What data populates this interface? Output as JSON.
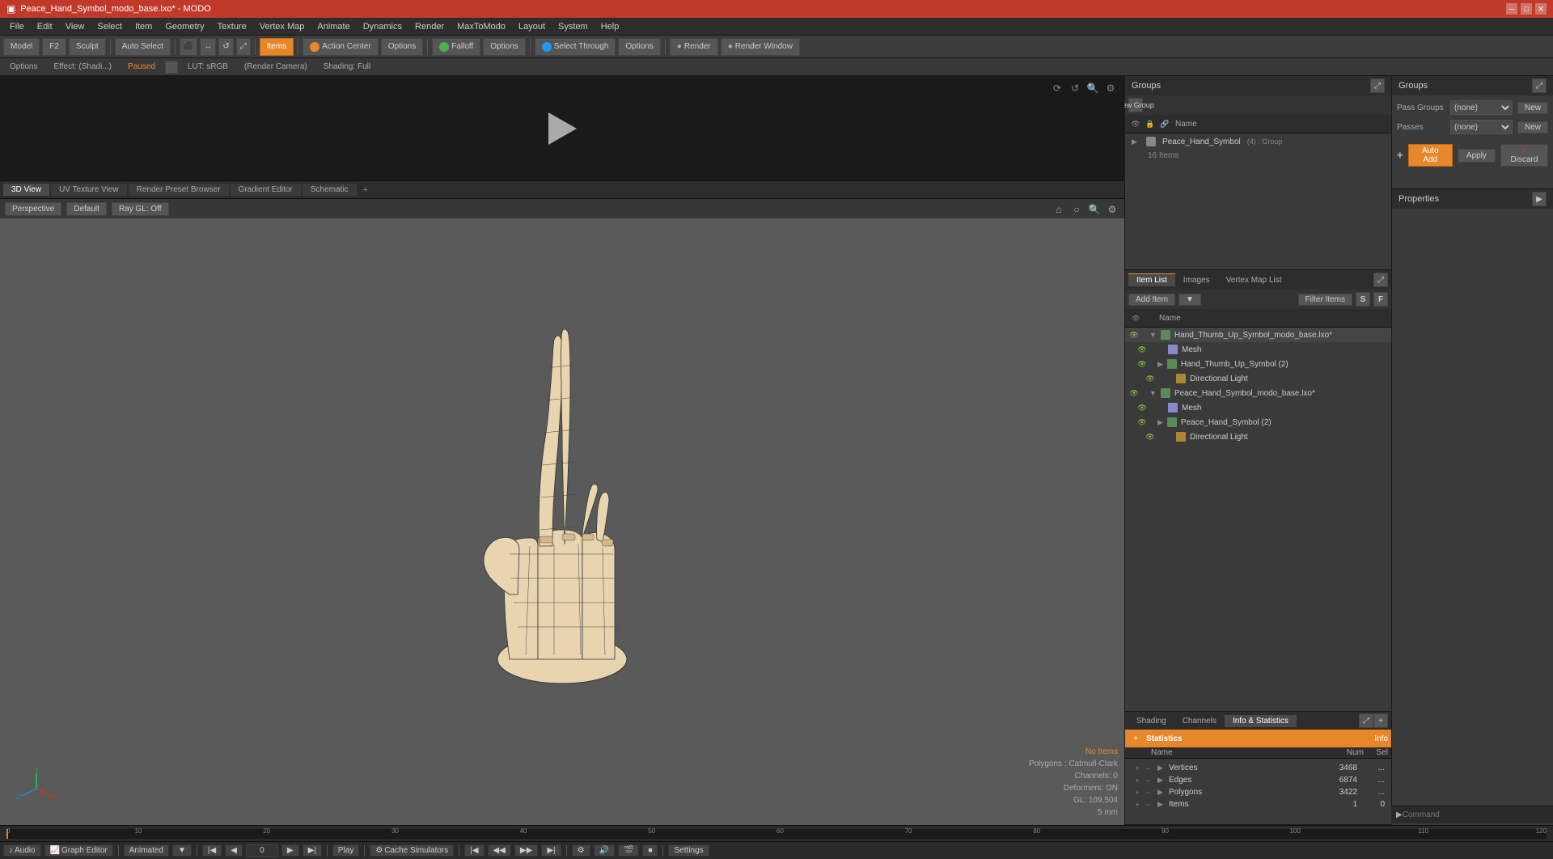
{
  "window": {
    "title": "Peace_Hand_Symbol_modo_base.lxo* - MODO",
    "icon": "modo-icon"
  },
  "menubar": {
    "items": [
      "File",
      "Edit",
      "View",
      "Select",
      "Item",
      "Geometry",
      "Texture",
      "Vertex Map",
      "Animate",
      "Dynamics",
      "Render",
      "MaxToModo",
      "Layout",
      "System",
      "Help"
    ]
  },
  "toolbar": {
    "model_label": "Model",
    "f2_label": "F2",
    "sculpt_label": "Sculpt",
    "auto_select_label": "Auto Select",
    "items_label": "Items",
    "action_center_label": "Action Center",
    "options_label": "Options",
    "falloff_label": "Falloff",
    "falloff_options": "Options",
    "select_through_label": "Select Through",
    "select_through_options": "Options",
    "render_label": "Render",
    "render_window_label": "Render Window"
  },
  "secondary_toolbar": {
    "left": "Options",
    "effect": "Effect: (Shadi...)",
    "status": "Paused",
    "lut": "LUT: sRGB",
    "render_camera": "(Render Camera)",
    "shading": "Shading: Full"
  },
  "viewport": {
    "tabs": [
      "3D View",
      "UV Texture View",
      "Render Preset Browser",
      "Gradient Editor",
      "Schematic"
    ],
    "active_tab": "3D View",
    "perspective_label": "Perspective",
    "default_label": "Default",
    "ray_gl": "Ray GL: Off",
    "stats": {
      "no_items": "No Items",
      "polygons": "Polygons : Catmull-Clark",
      "channels": "Channels: 0",
      "deformers": "Deformers: ON",
      "gl": "GL: 109,504",
      "unit": "5 mm"
    }
  },
  "groups_panel": {
    "title": "Groups",
    "new_group_label": "New Group",
    "name_col": "Name",
    "group_item": {
      "name": "Peace_Hand_Symbol",
      "meta": "(4) : Group",
      "sub": "16 Items"
    }
  },
  "item_list": {
    "title": "Item List",
    "tabs": [
      "Item List",
      "Images",
      "Vertex Map List"
    ],
    "add_item": "Add Item",
    "filter_items": "Filter Items",
    "name_col": "Name",
    "items": [
      {
        "name": "Hand_Thumb_Up_Symbol_modo_base.lxo*",
        "indent": 0,
        "type": "scene",
        "expanded": true
      },
      {
        "name": "Mesh",
        "indent": 1,
        "type": "mesh"
      },
      {
        "name": "Hand_Thumb_Up_Symbol (2)",
        "indent": 1,
        "type": "group",
        "expanded": true
      },
      {
        "name": "Directional Light",
        "indent": 2,
        "type": "light"
      },
      {
        "name": "Peace_Hand_Symbol_modo_base.lxo*",
        "indent": 0,
        "type": "scene",
        "expanded": true
      },
      {
        "name": "Mesh",
        "indent": 1,
        "type": "mesh"
      },
      {
        "name": "Peace_Hand_Symbol (2)",
        "indent": 1,
        "type": "group",
        "expanded": true
      },
      {
        "name": "Directional Light",
        "indent": 2,
        "type": "light"
      }
    ]
  },
  "stats_panel": {
    "tabs": [
      "Shading",
      "Channels",
      "Info & Statistics"
    ],
    "active_tab": "Info & Statistics",
    "section": "Statistics",
    "info_col": "Info",
    "rows": [
      {
        "name": "Vertices",
        "num": "3468",
        "sel": "..."
      },
      {
        "name": "Edges",
        "num": "6874",
        "sel": "..."
      },
      {
        "name": "Polygons",
        "num": "3422",
        "sel": "..."
      },
      {
        "name": "Items",
        "num": "1",
        "sel": "0"
      }
    ]
  },
  "properties_panel": {
    "title": "Properties",
    "groups_title": "Groups",
    "pass_groups_label": "Pass Groups",
    "passes_label": "Passes",
    "pass_groups_value": "(none)",
    "passes_value": "(none)",
    "new_label": "New",
    "auto_add_label": "Auto Add",
    "apply_label": "Apply",
    "discard_label": "Discard"
  },
  "timeline": {
    "markers": [
      "0",
      "10",
      "20",
      "30",
      "40",
      "50",
      "60",
      "70",
      "80",
      "90",
      "100",
      "110",
      "120"
    ],
    "current_frame": "0"
  },
  "bottom_bar": {
    "audio_label": "Audio",
    "graph_editor_label": "Graph Editor",
    "animated_label": "Animated",
    "play_label": "Play",
    "cache_label": "Cache Simulators",
    "settings_label": "Settings",
    "frame_value": "0",
    "command_label": "Command"
  }
}
